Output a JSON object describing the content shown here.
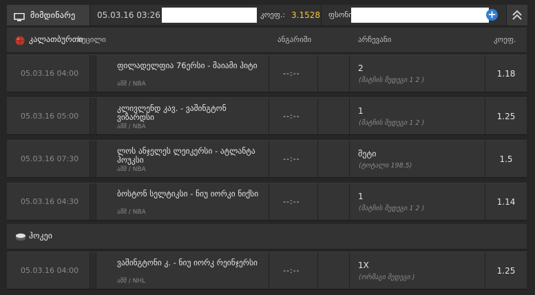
{
  "header": {
    "tab_label": "მიმდინარე",
    "datetime": "05.03.16 03:26",
    "coef_label": "კოეფ.:",
    "coef_value": "3.1528",
    "balance_label": "ფსონი"
  },
  "columns": {
    "event": "ხუცილი",
    "score": "ანგარიში",
    "pick": "არჩევანი",
    "coef": "კოეფ."
  },
  "sections": [
    {
      "sport": "კალათბურთი",
      "icon": "basketball-icon",
      "rows": [
        {
          "date": "05.03.16 04:00",
          "teams": "ფილადელფია 76ერსი - მაიამი ჰიტი",
          "league": "აშშ / NBA",
          "score": "--:--",
          "pick": "2",
          "pick_sub": "(მატჩის შედეგი 1 2 )",
          "coef": "1.18"
        },
        {
          "date": "05.03.16 05:00",
          "teams": "კლივლენდ კავ. - ვაშინგტონ ვიზარდსი",
          "league": "აშშ / NBA",
          "score": "--:--",
          "pick": "1",
          "pick_sub": "(მატჩის შედეგი 1 2 )",
          "coef": "1.25"
        },
        {
          "date": "05.03.16 07:30",
          "teams": "ლოს ანჯელეს ლეიკერსი - ატლანტა ჰოუკსი",
          "league": "აშშ / NBA",
          "score": "--:--",
          "pick": "მეტი",
          "pick_sub": "(ტოტალი 198.5)",
          "coef": "1.5"
        },
        {
          "date": "05.03.16 04:30",
          "teams": "ბოსტონ სელტიკსი - ნიუ იორკი ნიქსი",
          "league": "აშშ / NBA",
          "score": "--:--",
          "pick": "1",
          "pick_sub": "(მატჩის შედეგი 1 2 )",
          "coef": "1.14"
        }
      ]
    },
    {
      "sport": "ჰოკეი",
      "icon": "hockey-puck-icon",
      "rows": [
        {
          "date": "05.03.16 04:00",
          "teams": "ვაშინგტონი კ. - ნიუ იორკ რეინჯერსი",
          "league": "აშშ / NHL",
          "score": "--:--",
          "pick": "1X",
          "pick_sub": "(ორმაგი შედეგი )",
          "coef": "1.25"
        }
      ]
    }
  ],
  "colors": {
    "accent_coef": "#f5c542",
    "plus_button": "#2f7fd6"
  }
}
